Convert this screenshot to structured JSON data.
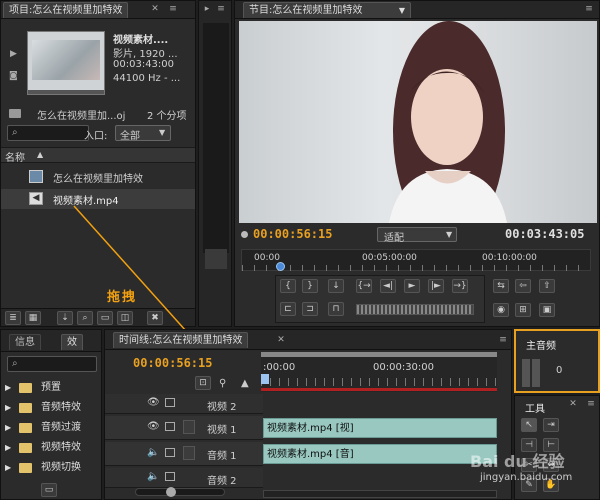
{
  "project_panel": {
    "tab_title": "项目:怎么在视频里加特效",
    "clip_name": "视频素材....",
    "clip_type": "影片, 1920 ...",
    "clip_duration": "00:03:43:00",
    "clip_audio": "44100 Hz - ...",
    "bin_name": "怎么在视频里加...oj",
    "item_count": "2 个分项",
    "search_placeholder": "",
    "entry_label": "入口:",
    "entry_value": "全部",
    "column_name": "名称",
    "items": [
      {
        "label": "怎么在视频里加特效",
        "icon": "sequence-icon"
      },
      {
        "label": "视频素材.mp4",
        "icon": "audio-clip-icon"
      }
    ]
  },
  "program_monitor": {
    "tab_title": "节目:怎么在视频里加特效",
    "current_time": "00:00:56:15",
    "fit_label": "适配",
    "duration": "00:03:43:05",
    "ruler_ticks": [
      "00:00",
      "00:05:00:00",
      "00:10:00:00"
    ],
    "playhead_fraction": 0.1,
    "playback_buttons": [
      "{",
      "}",
      "↓",
      "{→",
      "◄|",
      "►",
      "|►",
      "→}",
      "⇆",
      "⇦",
      "⇧",
      "◉"
    ]
  },
  "annotation": {
    "label": "拖拽",
    "color": "#f0a010"
  },
  "timeline": {
    "tab_title": "时间线:怎么在视频里加特效",
    "current_time": "00:00:56:15",
    "ruler_ticks": [
      ":00:00",
      "00:00:30:00"
    ],
    "tracks": [
      {
        "name": "视频 2",
        "clip": ""
      },
      {
        "name": "视频 1",
        "clip": "视频素材.mp4 [视]"
      },
      {
        "name": "音频 1",
        "clip": "视频素材.mp4 [音]"
      },
      {
        "name": "音频 2",
        "clip": ""
      }
    ]
  },
  "effects_panel": {
    "tab_info": "信息",
    "tab_effects": "效",
    "items": [
      "预置",
      "音频特效",
      "音频过渡",
      "视频特效",
      "视频切换"
    ]
  },
  "audio_master": {
    "tab_title": "主音频",
    "level": "0"
  },
  "tools": {
    "tab_title": "工具"
  },
  "watermark": {
    "brand": "Bai du 经验",
    "url": "jingyan.baidu.com"
  }
}
